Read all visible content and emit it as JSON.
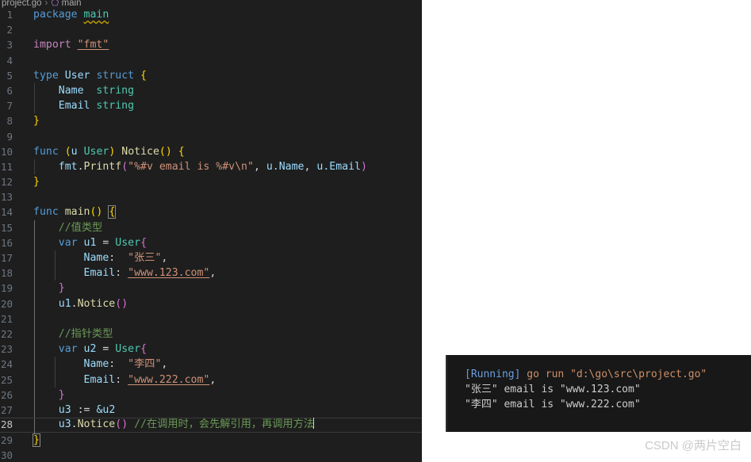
{
  "editor": {
    "breadcrumb": {
      "file": "project.go",
      "separator": "›",
      "symbol_icon": "symbol-method-icon",
      "symbol": "main"
    },
    "lines": [
      {
        "n": "1",
        "text": "package main"
      },
      {
        "n": "2",
        "text": ""
      },
      {
        "n": "3",
        "text": "import \"fmt\""
      },
      {
        "n": "4",
        "text": ""
      },
      {
        "n": "5",
        "text": "type User struct {"
      },
      {
        "n": "6",
        "text": "    Name  string"
      },
      {
        "n": "7",
        "text": "    Email string"
      },
      {
        "n": "8",
        "text": "}"
      },
      {
        "n": "9",
        "text": ""
      },
      {
        "n": "10",
        "text": "func (u User) Notice() {"
      },
      {
        "n": "11",
        "text": "    fmt.Printf(\"%#v email is %#v\\n\", u.Name, u.Email)"
      },
      {
        "n": "12",
        "text": "}"
      },
      {
        "n": "13",
        "text": ""
      },
      {
        "n": "14",
        "text": "func main() {"
      },
      {
        "n": "15",
        "text": "    //值类型"
      },
      {
        "n": "16",
        "text": "    var u1 = User{"
      },
      {
        "n": "17",
        "text": "        Name:  \"张三\","
      },
      {
        "n": "18",
        "text": "        Email: \"www.123.com\","
      },
      {
        "n": "19",
        "text": "    }"
      },
      {
        "n": "20",
        "text": "    u1.Notice()"
      },
      {
        "n": "21",
        "text": ""
      },
      {
        "n": "22",
        "text": "    //指针类型"
      },
      {
        "n": "23",
        "text": "    var u2 = User{"
      },
      {
        "n": "24",
        "text": "        Name:  \"李四\","
      },
      {
        "n": "25",
        "text": "        Email: \"www.222.com\","
      },
      {
        "n": "26",
        "text": "    }"
      },
      {
        "n": "27",
        "text": "    u3 := &u2"
      },
      {
        "n": "28",
        "text": "    u3.Notice() //在调用时，会先解引用，再调用方法"
      },
      {
        "n": "29",
        "text": "}"
      },
      {
        "n": "30",
        "text": ""
      }
    ],
    "tokens": {
      "kw_package": "package",
      "kw_import": "import",
      "kw_type": "type",
      "kw_struct": "struct",
      "kw_func": "func",
      "kw_var": "var",
      "kw_string": "string",
      "ident_main": "main",
      "ident_fmt_quoted": "\"fmt\"",
      "ident_User": "User",
      "ident_Name": "Name",
      "ident_Email": "Email",
      "ident_Notice": "Notice",
      "ident_Printf": "Printf",
      "ident_fmt": "fmt",
      "ident_u": "u",
      "ident_u1": "u1",
      "ident_u2": "u2",
      "ident_u3": "u3",
      "fmt_string": "\"%#v email is %#v\\n\"",
      "arg_uName": "u.Name",
      "arg_uEmail": "u.Email",
      "comment_value_type": "//值类型",
      "comment_pointer_type": "//指针类型",
      "comment_deref": "//在调用时，会先解引用，再调用方法",
      "str_zhangsan": "\"张三\"",
      "str_lisi": "\"李四\"",
      "str_url123": "\"www.123.com\"",
      "str_url222": "\"www.222.com\"",
      "assign": "=",
      "short_assign": ":=",
      "amp_u2": "&u2",
      "colon": ":",
      "comma": ",",
      "dot": ".",
      "lbrace": "{",
      "rbrace": "}",
      "lparen": "(",
      "rparen": ")",
      "empty_parens": "()"
    },
    "current_line": "28",
    "colors": {
      "background": "#1e1e1e",
      "keyword": "#569cd6",
      "keyword_control": "#c586c0",
      "type": "#4ec9b0",
      "variable": "#9cdcfe",
      "function": "#dcdcaa",
      "string": "#ce9178",
      "comment": "#6a9955",
      "bracket1": "#ffd700",
      "bracket2": "#da70d6",
      "bracket3": "#179fff",
      "line_number": "#6e7681",
      "line_number_active": "#c6c6c6"
    }
  },
  "terminal": {
    "lines": [
      {
        "prefix": "[Running]",
        "command": " go run \"d:\\go\\src\\project.go\""
      },
      {
        "prefix": "",
        "command": "",
        "plain": "\"张三\" email is \"www.123.com\""
      },
      {
        "prefix": "",
        "command": "",
        "plain": "\"李四\" email is \"www.222.com\""
      }
    ],
    "running_label": "[Running]",
    "run_command": " go run \"d:\\go\\src\\project.go\"",
    "output_line_1": "\"张三\" email is \"www.123.com\"",
    "output_line_2": "\"李四\" email is \"www.222.com\"",
    "colors": {
      "background": "#181818",
      "running": "#6a9ee0",
      "command": "#cd9069",
      "output": "#cccccc"
    }
  },
  "watermark": {
    "text": "CSDN @两片空白"
  }
}
